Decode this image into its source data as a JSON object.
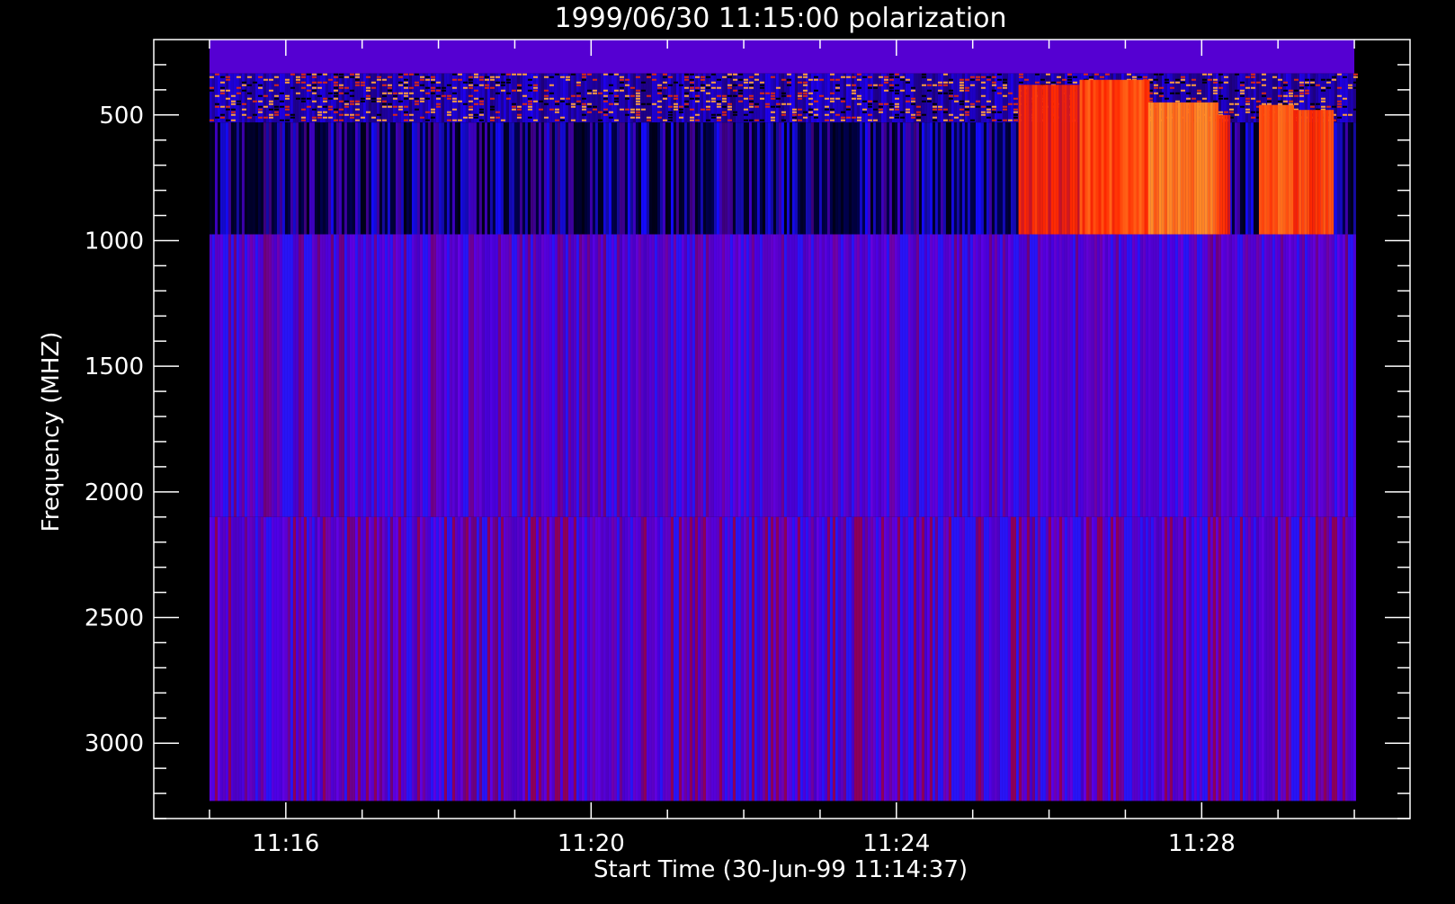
{
  "chart_data": {
    "type": "heatmap",
    "title": "1999/06/30 11:15:00 polarization",
    "xlabel": "Start Time (30-Jun-99 11:14:37)",
    "ylabel": "Frequency (MHZ)",
    "x_ticks": [
      "11:16",
      "11:20",
      "11:24",
      "11:28"
    ],
    "x_tick_minutes": [
      76,
      80,
      84,
      88
    ],
    "x_range_minutes": [
      74.27,
      90.73
    ],
    "data_x_range_minutes": [
      75.0,
      90.0
    ],
    "y_ticks": [
      500,
      1000,
      1500,
      2000,
      2500,
      3000
    ],
    "y_range": [
      200,
      3300
    ],
    "y_inverted": true,
    "grid": false,
    "bands": [
      {
        "f_min": 200,
        "f_max": 335,
        "level": 0.0,
        "texture": "flat"
      },
      {
        "f_min": 335,
        "f_max": 530,
        "level": 0.35,
        "texture": "noisy"
      },
      {
        "f_min": 530,
        "f_max": 975,
        "level": 0.1,
        "texture": "striped-dark"
      },
      {
        "f_min": 975,
        "f_max": 2100,
        "level": 0.05,
        "texture": "striped"
      },
      {
        "f_min": 2100,
        "f_max": 3230,
        "level": 0.15,
        "texture": "striped"
      }
    ],
    "bursts": [
      {
        "t_start": 85.6,
        "t_end": 86.4,
        "f_min": 380,
        "f_max": 975,
        "intensity": 0.65
      },
      {
        "t_start": 86.4,
        "t_end": 87.3,
        "f_min": 360,
        "f_max": 975,
        "intensity": 0.78
      },
      {
        "t_start": 87.3,
        "t_end": 88.2,
        "f_min": 450,
        "f_max": 975,
        "intensity": 0.95
      },
      {
        "t_start": 88.2,
        "t_end": 88.35,
        "f_min": 500,
        "f_max": 975,
        "intensity": 0.7
      },
      {
        "t_start": 88.75,
        "t_end": 89.2,
        "f_min": 460,
        "f_max": 975,
        "intensity": 0.85
      },
      {
        "t_start": 89.2,
        "t_end": 89.7,
        "f_min": 480,
        "f_max": 975,
        "intensity": 0.75
      }
    ]
  }
}
